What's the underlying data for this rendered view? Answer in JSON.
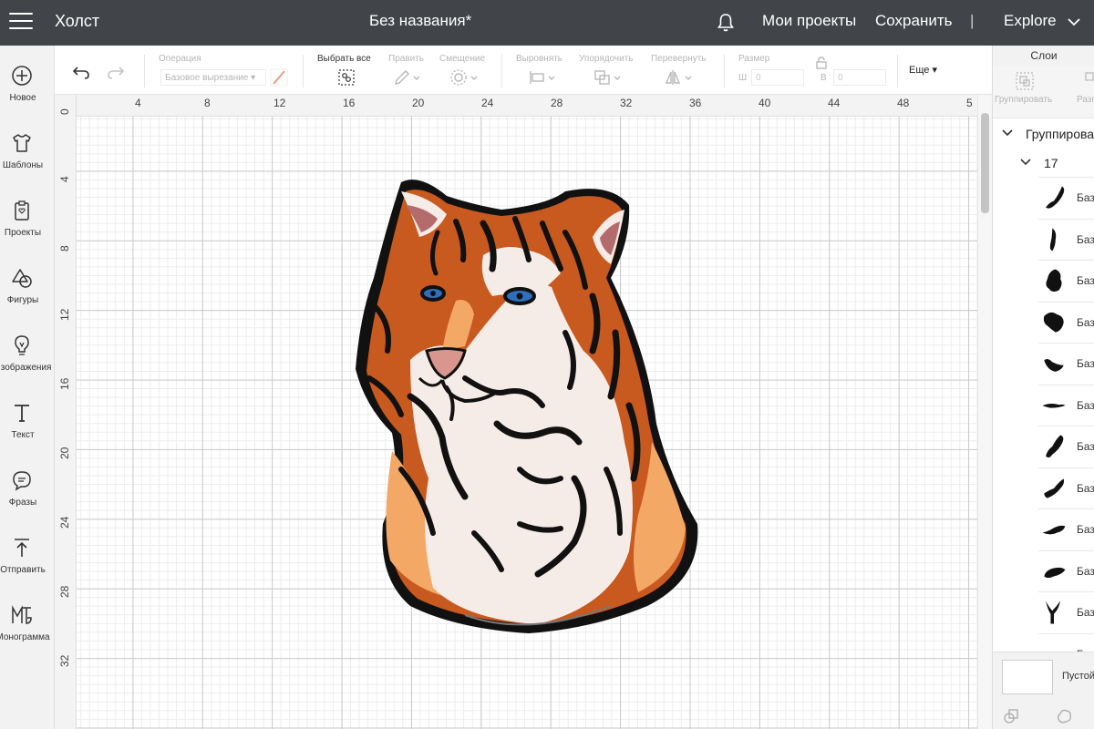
{
  "topbar": {
    "app_title": "Холст",
    "document_title": "Без названия*",
    "my_projects": "Мои проекты",
    "save": "Сохранить",
    "separator": "|",
    "explore": "Explore"
  },
  "sidebar": {
    "items": [
      {
        "label": "Новое",
        "icon": "plus-circle-icon"
      },
      {
        "label": "Шаблоны",
        "icon": "tshirt-icon"
      },
      {
        "label": "Проекты",
        "icon": "clipboard-icon"
      },
      {
        "label": "Фигуры",
        "icon": "shapes-icon"
      },
      {
        "label": "Изображения",
        "icon": "lightbulb-icon"
      },
      {
        "label": "Текст",
        "icon": "text-icon"
      },
      {
        "label": "Фразы",
        "icon": "speech-bubble-icon"
      },
      {
        "label": "Отправить",
        "icon": "upload-icon"
      },
      {
        "label": "Монограмма",
        "icon": "monogram-icon"
      }
    ]
  },
  "toolbar": {
    "operation_label": "Операция",
    "operation_value": "Базовое вырезание",
    "select_all": "Выбрать все",
    "edit": "Править",
    "offset": "Смещение",
    "align": "Выровнять",
    "arrange": "Упорядочить",
    "flip": "Перевернуть",
    "size": "Размер",
    "width_prefix": "Ш",
    "width_value": "0",
    "height_prefix": "В",
    "height_value": "0",
    "more": "Еще"
  },
  "rulers": {
    "horizontal": [
      "4",
      "8",
      "12",
      "16",
      "20",
      "24",
      "28",
      "32",
      "36",
      "40",
      "44",
      "48",
      "5"
    ],
    "vertical": [
      "0",
      "4",
      "8",
      "12",
      "16",
      "20",
      "24",
      "28",
      "32"
    ]
  },
  "layers_panel": {
    "title": "Слои",
    "group_button": "Группировать",
    "ungroup_button": "Разгруппировать",
    "group_row": "Группирова",
    "subgroup_row": "17",
    "layer_name": "Баз",
    "layers": [
      "Баз",
      "Баз",
      "Баз",
      "Баз",
      "Баз",
      "Баз",
      "Баз",
      "Баз",
      "Баз",
      "Баз",
      "Баз",
      "Баз"
    ],
    "blank_canvas": "Пустой"
  },
  "colors": {
    "topbar": "#414549",
    "tiger_orange": "#c8591f",
    "tiger_light_orange": "#f3a866",
    "tiger_cream": "#f6ece7",
    "eye_blue": "#2f6fc0",
    "nose_pink": "#d9968f"
  }
}
